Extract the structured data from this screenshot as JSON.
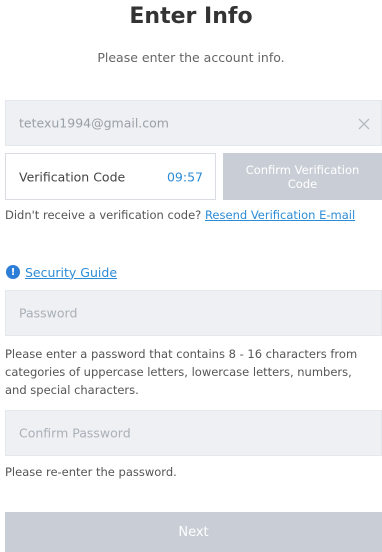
{
  "header": {
    "title": "Enter Info",
    "subtitle": "Please enter the account info."
  },
  "email": {
    "value": "tetexu1994@gmail.com",
    "clear_icon": "close-icon"
  },
  "verification": {
    "placeholder": "Verification Code",
    "countdown": "09:57",
    "confirm_label": "Confirm Verification Code",
    "resend_prompt": "Didn't receive a verification code?",
    "resend_link": "Resend Verification E-mail"
  },
  "security_guide": {
    "icon": "info-icon",
    "icon_glyph": "!",
    "label": "Security Guide"
  },
  "password": {
    "placeholder": "Password",
    "hint": "Please enter a password that contains 8 - 16 characters from categories of uppercase letters, lowercase letters, numbers, and special characters."
  },
  "confirm_password": {
    "placeholder": "Confirm Password",
    "hint": "Please re-enter the password."
  },
  "actions": {
    "next_label": "Next"
  },
  "colors": {
    "accent": "#2d8cd6",
    "disabled_button": "#c9ced6",
    "field_background": "#eef0f3"
  }
}
